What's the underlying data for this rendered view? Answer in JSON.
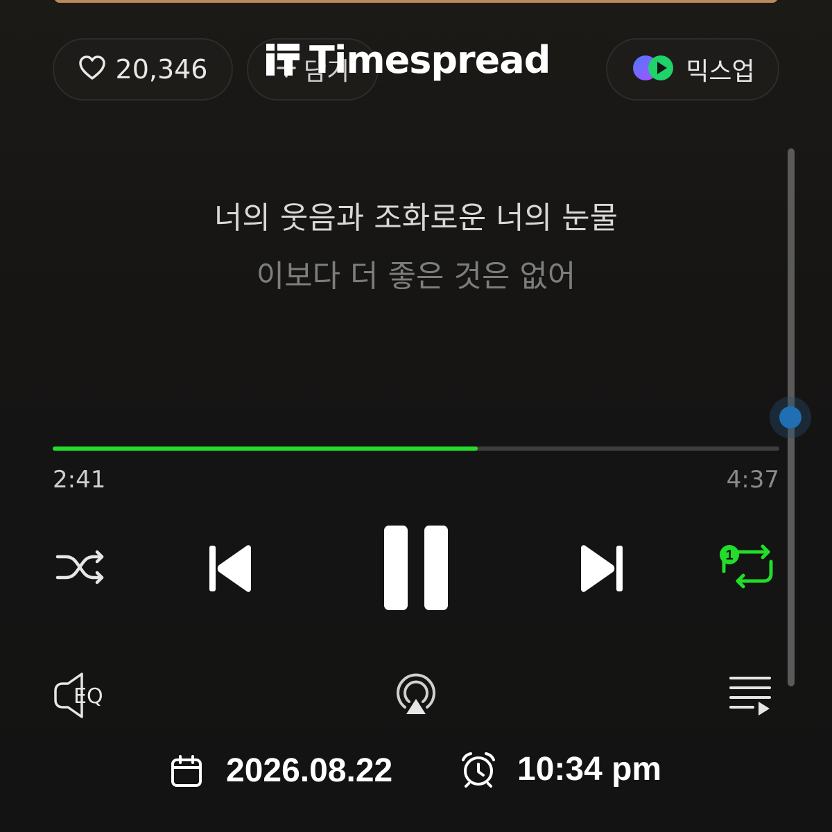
{
  "header": {
    "like_count": "20,346",
    "add_label": "담기",
    "mixup_label": "믹스업"
  },
  "watermark": {
    "text": "Timespread"
  },
  "lyrics": {
    "current": "너의 웃음과 조화로운 너의 눈물",
    "next": "이보다 더 좋은 것은 없어"
  },
  "player": {
    "elapsed": "2:41",
    "total": "4:37",
    "progress": 0.585,
    "repeat_badge": "1",
    "accent_color": "#22dd2a",
    "eq_label": "EQ"
  },
  "icons": {
    "like": "heart-icon",
    "add": "plus-icon",
    "mixup": "mixup-icon",
    "shuffle": "shuffle-icon",
    "prev": "previous-icon",
    "pause": "pause-icon",
    "next": "next-icon",
    "repeat": "repeat-one-icon",
    "eq": "equalizer-icon",
    "airplay": "airplay-icon",
    "playlist": "playlist-icon",
    "calendar": "calendar-icon",
    "alarm": "alarm-clock-icon"
  },
  "footer": {
    "date": "2026.08.22",
    "time": "10:34 pm"
  }
}
